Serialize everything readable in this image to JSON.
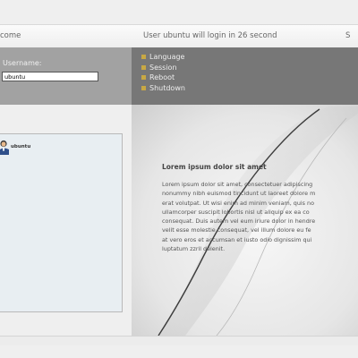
{
  "topbar": {
    "welcome": "come",
    "countdown": "User ubuntu will login in 26 second",
    "tail": "S"
  },
  "login": {
    "username_label": "Username:",
    "username_value": "ubuntu"
  },
  "menu": {
    "items": [
      {
        "label": "Language",
        "icon": "bullet-icon"
      },
      {
        "label": "Session",
        "icon": "bullet-icon"
      },
      {
        "label": "Reboot",
        "icon": "bullet-icon"
      },
      {
        "label": "Shutdown",
        "icon": "bullet-icon"
      }
    ]
  },
  "users": [
    {
      "name": "ubuntu",
      "icon": "user-avatar-icon"
    }
  ],
  "content": {
    "title": "Lorem ipsum dolor sit amet",
    "body": "Lorem ipsum dolor sit amet, consectetuer adipiscing\nnonummy nibh euismod tincidunt ut laoreet dolore m\nerat volutpat. Ut wisi enim ad minim veniam, quis no\nullamcorper suscipit lobortis nisl ut aliquip ex ea co\nconsequat. Duis autem vel eum iriure dolor in hendre\nvelit esse molestie consequat, vel illum dolore eu fe\nat vero eros et accumsan et iusto odio dignissim qui\nluptatum zzril delenit."
  },
  "colors": {
    "login_bg": "#a2a2a2",
    "menu_bg": "#777777",
    "bullet": "#c8a844",
    "users_panel_bg": "#e8eef2"
  }
}
